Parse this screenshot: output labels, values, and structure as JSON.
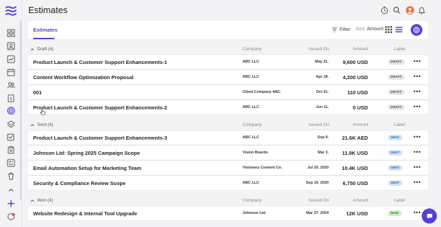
{
  "header": {
    "title": "Estimates"
  },
  "toolbar": {
    "tab_label": "Estimates",
    "filter_label": "Filter",
    "sort_prefix": "Sort:",
    "sort_value": "Amount"
  },
  "columns": {
    "company": "Company",
    "issued_on": "Issued On",
    "amount": "Amount",
    "label": "Label"
  },
  "groups": [
    {
      "title": "Draft (4)",
      "rows": [
        {
          "title": "Product Launch & Customer Support Enhancements-1",
          "company": "ABC LLC",
          "date": "May 21.",
          "amount": "9,600 USD",
          "label": "DRAFT"
        },
        {
          "title": "Content Workflow Optimization Proposal",
          "company": "ABC LLC",
          "date": "Apr 18.",
          "amount": "4,200 USD",
          "label": "DRAFT"
        },
        {
          "title": "001",
          "company": "Client Company ABC",
          "date": "Oct 21.",
          "amount": "110 USD",
          "label": "DRAFT"
        },
        {
          "title": "Product Launch & Customer Support Enhancements-2",
          "company": "ABC LLC",
          "date": "Jun 11.",
          "amount": "0 USD",
          "label": "DRAFT"
        }
      ]
    },
    {
      "title": "Sent (4)",
      "rows": [
        {
          "title": "Product Launch & Customer Support Enhancements-3",
          "company": "ABC LLC",
          "date": "Sep 9.",
          "amount": "21.6K AED",
          "label": "SENT"
        },
        {
          "title": "Johnson Ltd: Spring 2025 Campaign Scope",
          "company": "Vision Boards",
          "date": "Mar 3.",
          "amount": "11.8K USD",
          "label": "SENT"
        },
        {
          "title": "Email Automation Setup for Marketing Team",
          "company": "Visionary Content Co.",
          "date": "Jul 20. 2020",
          "amount": "10.4K USD",
          "label": "SENT"
        },
        {
          "title": "Security & Compliance Review Scope",
          "company": "ABC LLC",
          "date": "Sep 10. 2020",
          "amount": "6,750 USD",
          "label": "SENT"
        }
      ]
    },
    {
      "title": "Won (4)",
      "rows": [
        {
          "title": "Website Redesign & Internal Tool Upgrade",
          "company": "Johnson Ltd.",
          "date": "Mar 27. 2024",
          "amount": "12K USD",
          "label": "WON"
        }
      ]
    }
  ],
  "colors": {
    "accent": "#5a3fd6",
    "avatar": "#e8743b",
    "draft_badge": "#e4e4e8",
    "sent_badge": "#cfe3fb",
    "won_badge": "#c9efc2"
  },
  "icons": {
    "sidebar": [
      "dashboard-icon",
      "contacts-icon",
      "reports-icon",
      "calendar-icon",
      "people-icon",
      "invoice-icon",
      "estimates-icon",
      "layers-icon",
      "tasks-icon",
      "clipboard-icon",
      "checklist-icon",
      "trash-icon",
      "chevron-up-icon",
      "plus-icon",
      "notification-icon"
    ],
    "header": [
      "timer-icon",
      "search-icon",
      "avatar",
      "bell-icon"
    ]
  }
}
